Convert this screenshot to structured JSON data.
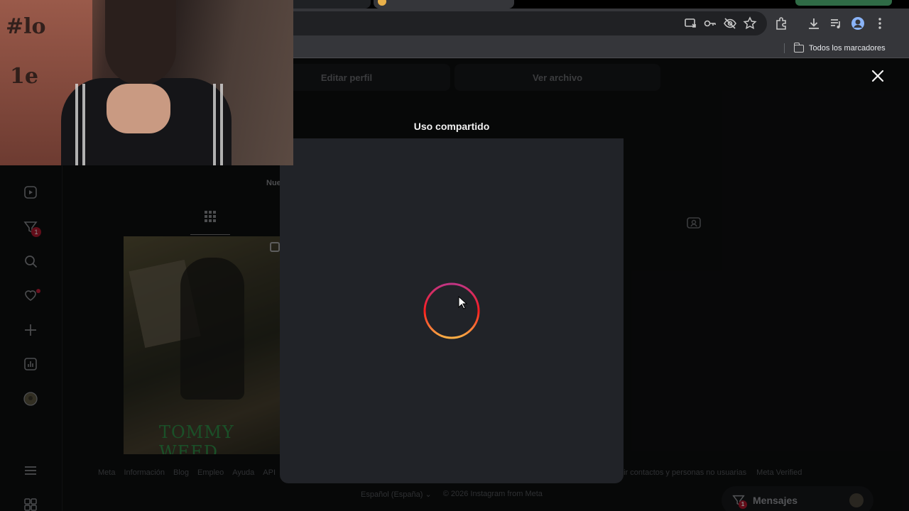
{
  "browser": {
    "bookmarks_folder_label": "Todos los marcadores",
    "toolbar_icons": [
      "install-app-icon",
      "password-key-icon",
      "eye-off-icon",
      "star-icon",
      "extensions-icon",
      "download-icon",
      "media-control-icon",
      "profile-icon",
      "kebab-menu-icon"
    ]
  },
  "profile": {
    "edit_profile_label": "Editar perfil",
    "view_archive_label": "Ver archivo",
    "new_label": "Nue"
  },
  "modal": {
    "title": "Uso compartido",
    "loading": true,
    "spinner_colors": [
      "#c13584",
      "#fd1d1d",
      "#fcaf45"
    ]
  },
  "footer": {
    "links": [
      "Meta",
      "Información",
      "Blog",
      "Empleo",
      "Ayuda",
      "API"
    ],
    "links_right": [
      "bir contactos y personas no usuarias",
      "Meta Verified"
    ],
    "language": "Español (España)",
    "copyright": "© 2026 Instagram from Meta"
  },
  "messages": {
    "label": "Mensajes",
    "badge": "1"
  },
  "sidebar": {
    "notification_badge": "1"
  },
  "post": {
    "overlay_text": "TOMMY WEED"
  }
}
